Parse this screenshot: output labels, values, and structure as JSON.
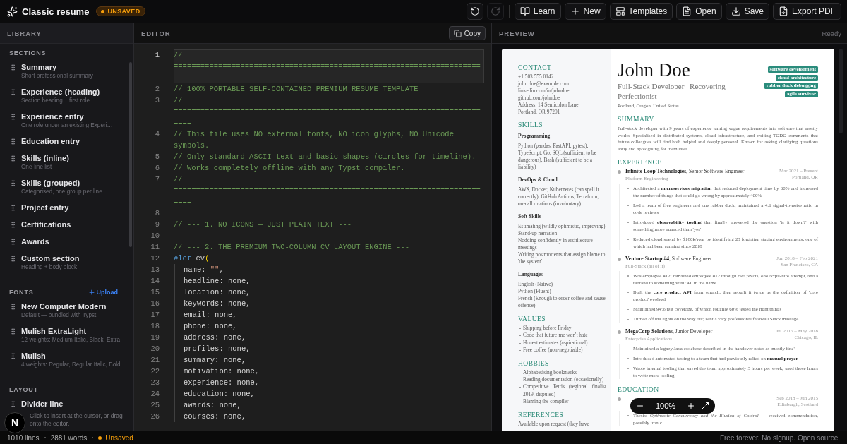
{
  "app": {
    "title": "Classic resume",
    "badge": "UNSAVED",
    "dev_badge": "N"
  },
  "toolbar": {
    "buttons": [
      {
        "kind": "undo",
        "disabled": false
      },
      {
        "kind": "redo",
        "disabled": true
      },
      {
        "kind": "learn",
        "label": "Learn",
        "disabled": false
      },
      {
        "kind": "new",
        "label": "New",
        "disabled": false
      },
      {
        "kind": "templates",
        "label": "Templates",
        "disabled": false
      },
      {
        "kind": "open",
        "label": "Open",
        "disabled": false
      },
      {
        "kind": "save",
        "label": "Save",
        "disabled": false
      },
      {
        "kind": "export",
        "label": "Export PDF",
        "disabled": false
      }
    ]
  },
  "library": {
    "title": "LIBRARY",
    "groups": [
      {
        "title": "SECTIONS",
        "items": [
          {
            "title": "Summary",
            "subtitle": "Short professional summary"
          },
          {
            "title": "Experience (heading)",
            "subtitle": "Section heading + first role"
          },
          {
            "title": "Experience entry",
            "subtitle": "One role under an existing Experi…"
          },
          {
            "title": "Education entry"
          },
          {
            "title": "Skills (inline)",
            "subtitle": "One-line list"
          },
          {
            "title": "Skills (grouped)",
            "subtitle": "Categorised, one group per line"
          },
          {
            "title": "Project entry"
          },
          {
            "title": "Certifications"
          },
          {
            "title": "Awards"
          },
          {
            "title": "Custom section",
            "subtitle": "Heading + body block"
          }
        ]
      },
      {
        "title": "FONTS",
        "action": "Upload",
        "items": [
          {
            "title": "New Computer Modern",
            "subtitle": "Default — bundled with Typst"
          },
          {
            "title": "Mulish ExtraLight",
            "subtitle": "12 weights: Medium Italic, Black, Extra"
          },
          {
            "title": "Mulish",
            "subtitle": "4 weights: Regular, Regular Italic, Bold"
          }
        ]
      },
      {
        "title": "LAYOUT",
        "items": [
          {
            "title": "Divider line"
          }
        ]
      }
    ],
    "hint": "Click to insert at the cursor, or drag onto the editor."
  },
  "editor": {
    "title": "EDITOR",
    "copy_label": "Copy",
    "lines": [
      {
        "number": "1",
        "active": true,
        "tokens": [
          {
            "kind": "comment",
            "text": "// ========================================================================="
          }
        ]
      },
      {
        "number": "2",
        "active": false,
        "tokens": [
          {
            "kind": "comment",
            "text": "// 100% PORTABLE SELF-CONTAINED PREMIUM RESUME TEMPLATE"
          }
        ]
      },
      {
        "number": "3",
        "active": false,
        "tokens": [
          {
            "kind": "comment",
            "text": "// ========================================================================="
          }
        ]
      },
      {
        "number": "4",
        "active": false,
        "tokens": [
          {
            "kind": "comment",
            "text": "// This file uses NO external fonts, NO icon glyphs, NO Unicode symbols."
          }
        ]
      },
      {
        "number": "5",
        "active": false,
        "tokens": [
          {
            "kind": "comment",
            "text": "// Only standard ASCII text and basic shapes (circles for timeline)."
          }
        ]
      },
      {
        "number": "6",
        "active": false,
        "tokens": [
          {
            "kind": "comment",
            "text": "// Works completely offline with any Typst compiler."
          }
        ]
      },
      {
        "number": "7",
        "active": false,
        "tokens": [
          {
            "kind": "comment",
            "text": "// ========================================================================="
          }
        ]
      },
      {
        "number": "8",
        "active": false
      },
      {
        "number": "9",
        "active": false,
        "tokens": [
          {
            "kind": "comment",
            "text": "// --- 1. NO ICONS — JUST PLAIN TEXT ---"
          }
        ]
      },
      {
        "number": "10",
        "active": false
      },
      {
        "number": "11",
        "active": false,
        "tokens": [
          {
            "kind": "comment",
            "text": "// --- 2. THE PREMIUM TWO-COLUMN CV LAYOUT ENGINE ---"
          }
        ]
      },
      {
        "number": "12",
        "active": false,
        "tokens": [
          {
            "kind": "keyword",
            "text": "#let"
          },
          {
            "kind": "plain",
            "text": " cv"
          },
          {
            "kind": "bracket",
            "text": "("
          }
        ]
      },
      {
        "number": "13",
        "active": false,
        "indented": true,
        "tokens": [
          {
            "kind": "plain",
            "text": "name: "
          },
          {
            "kind": "string",
            "text": "\"\""
          },
          {
            "kind": "plain",
            "text": ","
          }
        ]
      },
      {
        "number": "14",
        "active": false,
        "indented": true,
        "tokens": [
          {
            "kind": "plain",
            "text": "headline: none,"
          }
        ]
      },
      {
        "number": "15",
        "active": false,
        "indented": true,
        "tokens": [
          {
            "kind": "plain",
            "text": "location: none,"
          }
        ]
      },
      {
        "number": "16",
        "active": false,
        "indented": true,
        "tokens": [
          {
            "kind": "plain",
            "text": "keywords: none,"
          }
        ]
      },
      {
        "number": "17",
        "active": false,
        "indented": true,
        "tokens": [
          {
            "kind": "plain",
            "text": "email: none,"
          }
        ]
      },
      {
        "number": "18",
        "active": false,
        "indented": true,
        "tokens": [
          {
            "kind": "plain",
            "text": "phone: none,"
          }
        ]
      },
      {
        "number": "19",
        "active": false,
        "indented": true,
        "tokens": [
          {
            "kind": "plain",
            "text": "address: none,"
          }
        ]
      },
      {
        "number": "20",
        "active": false,
        "indented": true,
        "tokens": [
          {
            "kind": "plain",
            "text": "profiles: none,"
          }
        ]
      },
      {
        "number": "21",
        "active": false,
        "indented": true,
        "tokens": [
          {
            "kind": "plain",
            "text": "summary: none,"
          }
        ]
      },
      {
        "number": "22",
        "active": false,
        "indented": true,
        "tokens": [
          {
            "kind": "plain",
            "text": "motivation: none,"
          }
        ]
      },
      {
        "number": "23",
        "active": false,
        "indented": true,
        "tokens": [
          {
            "kind": "plain",
            "text": "experience: none,"
          }
        ]
      },
      {
        "number": "24",
        "active": false,
        "indented": true,
        "tokens": [
          {
            "kind": "plain",
            "text": "education: none,"
          }
        ]
      },
      {
        "number": "25",
        "active": false,
        "indented": true,
        "tokens": [
          {
            "kind": "plain",
            "text": "awards: none,"
          }
        ]
      },
      {
        "number": "26",
        "active": false,
        "indented": true,
        "tokens": [
          {
            "kind": "plain",
            "text": "courses: none,"
          }
        ]
      }
    ]
  },
  "preview": {
    "title": "PREVIEW",
    "status": "Ready",
    "zoom": "100%",
    "resume": {
      "sidebar": [
        {
          "kind": "lines",
          "heading": "CONTACT",
          "lines": [
            "+1 503 555 0142",
            "john.doe@example.com",
            "linkedin.com/in/johndoe",
            "github.com/johndoe",
            "Address: 14 Semicolon Lane",
            "Portland, OR 97201"
          ]
        },
        {
          "kind": "groups",
          "heading": "SKILLS",
          "groups": [
            {
              "title": "Programming",
              "lines": [
                "Python (pandas, FastAPI, pytest), TypeScript, Go, SQL (sufficient to be dangerous), Bash (sufficient to be a liability)"
              ]
            },
            {
              "title": "DevOps & Cloud",
              "lines": [
                "AWS, Docker, Kubernetes (can spell it correctly), GitHub Actions, Terraform, on-call rotations (involuntary)"
              ]
            },
            {
              "title": "Soft Skills",
              "lines": [
                "Estimating (wildly optimistic, improving)",
                "Stand-up narration",
                "Nodding confidently in architecture meetings",
                "Writing postmortems that assign blame to 'the system'"
              ]
            },
            {
              "title": "Languages",
              "lines": [
                "English (Native)",
                "Python (Fluent)",
                "French (Enough to order coffee and cause offence)"
              ]
            }
          ]
        },
        {
          "kind": "list",
          "heading": "VALUES",
          "items": [
            "Shipping before Friday",
            "Code that future-me won't hate",
            "Honest estimates (aspirational)",
            "Free coffee (non-negotiable)"
          ]
        },
        {
          "kind": "list",
          "heading": "HOBBIES",
          "items": [
            "Alphabetising bookmarks",
            "Reading documentation (occasionally)",
            "Competitive Tetris (regional finalist 2019, disputed)",
            "Blaming the compiler"
          ]
        },
        {
          "kind": "lines",
          "heading": "REFERENCES",
          "lines": [
            "Available upon request (they have"
          ]
        }
      ],
      "name": "John Doe",
      "headline": "Full-Stack Developer | Recovering Perfectionist",
      "location": "Portland, Oregon, United States",
      "tags": [
        "software development",
        "cloud architecture",
        "rubber duck debugging",
        "agile survivor"
      ],
      "sections": [
        {
          "kind": "text",
          "heading": "SUMMARY",
          "text": "Full-stack developer with 9 years of experience turning vague requirements into software that mostly works. Specialised in distributed systems, cloud infrastructure, and writing TODO comments that future colleagues will find both helpful and deeply personal. Known for asking clarifying questions early and apologising for them later."
        },
        {
          "kind": "entries",
          "heading": "EXPERIENCE",
          "entries": [
            {
              "title": "**Infinite Loop Technologies**, Senior Software Engineer",
              "subtitle": "Platform Engineering",
              "dates": "Mar 2021 – Present",
              "location": "Portland, OR",
              "bullets": [
                "Architected a **microservices migration** that reduced deployment time by 60% and increased the number of things that could go wrong by approximately 400%",
                "Led a team of five engineers and one rubber duck; maintained a 4:1 signal-to-noise ratio in code reviews",
                "Introduced **observability tooling** that finally answered the question 'is it down?' with something more nuanced than 'yes'",
                "Reduced cloud spend by $180k/year by identifying 23 forgotten staging environments, one of which had been running since 2018"
              ]
            },
            {
              "title": "**Venture Startup #4**, Software Engineer",
              "subtitle": "Full-Stack (all of it)",
              "dates": "Jun 2018 – Feb 2021",
              "location": "San Francisco, CA",
              "bullets": [
                "Was employee #12; remained employee #12 through two pivots, one acqui-hire attempt, and a rebrand to something with 'AI' in the name",
                "Built the **core product API** from scratch, then rebuilt it twice as the definition of 'core product' evolved",
                "Maintained 94% test coverage, of which roughly 60% tested the right things",
                "Turned off the lights on the way out; sent a very professional farewell Slack message"
              ]
            },
            {
              "title": "**MegaCorp Solutions**, Junior Developer",
              "subtitle": "Enterprise Applications",
              "dates": "Jul 2015 – May 2018",
              "location": "Chicago, IL",
              "bullets": [
                "Maintained a legacy Java codebase described in the handover notes as 'mostly fine'",
                "Introduced automated testing to a team that had previously relied on **manual prayer**",
                "Wrote internal tooling that saved the team approximately 3 hours per week; used those hours to write more tooling"
              ]
            }
          ]
        },
        {
          "kind": "entries",
          "heading": "EDUCATION",
          "entries": [
            {
              "dates": "Sep 2013 – Jun 2015",
              "location": "Edinburgh, Scotland",
              "bullets": [
                "Thesis: *Optimistic Concurrency and the Illusion of Control* — received commendation, possibly ironic"
              ]
            }
          ]
        }
      ]
    }
  },
  "status_bar": {
    "items": [
      {
        "kind": "count",
        "text": "1010 lines"
      },
      {
        "kind": "count",
        "text": "2881 words"
      },
      {
        "kind": "unsaved",
        "text": "Unsaved"
      }
    ],
    "tagline": "Free forever. No signup. Open source."
  }
}
